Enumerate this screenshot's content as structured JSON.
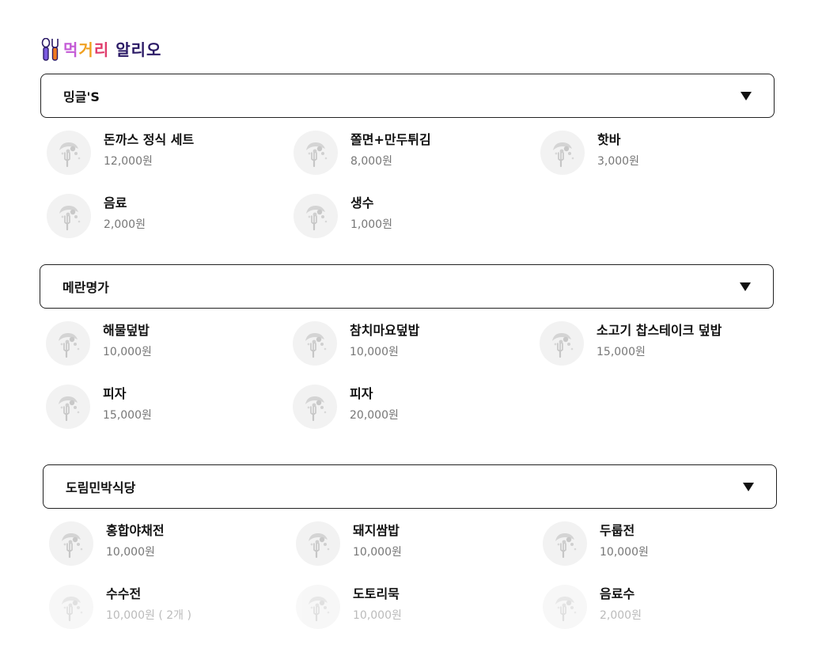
{
  "logo": {
    "text": "먹거리 알리오"
  },
  "sections": [
    {
      "title": "밍글'S",
      "items": [
        {
          "name": "돈까스 정식 세트",
          "price": "12,000원"
        },
        {
          "name": "쫄면+만두튀김",
          "price": "8,000원"
        },
        {
          "name": "핫바",
          "price": "3,000원"
        },
        {
          "name": "음료",
          "price": "2,000원"
        },
        {
          "name": "생수",
          "price": "1,000원"
        }
      ]
    },
    {
      "title": "메란명가",
      "items": [
        {
          "name": "해물덮밥",
          "price": "10,000원"
        },
        {
          "name": "참치마요덮밥",
          "price": "10,000원"
        },
        {
          "name": "소고기 찹스테이크 덮밥",
          "price": "15,000원"
        },
        {
          "name": "피자",
          "price": "15,000원"
        },
        {
          "name": "피자",
          "price": "20,000원"
        }
      ]
    },
    {
      "title": "도림민박식당",
      "items": [
        {
          "name": "홍합야채전",
          "price": "10,000원"
        },
        {
          "name": "돼지쌈밥",
          "price": "10,000원"
        },
        {
          "name": "두룹전",
          "price": "10,000원"
        },
        {
          "name": "수수전",
          "price": "10,000원 ( 2개 )"
        },
        {
          "name": "도토리묵",
          "price": "10,000원"
        },
        {
          "name": "음료수",
          "price": "2,000원"
        }
      ]
    }
  ]
}
